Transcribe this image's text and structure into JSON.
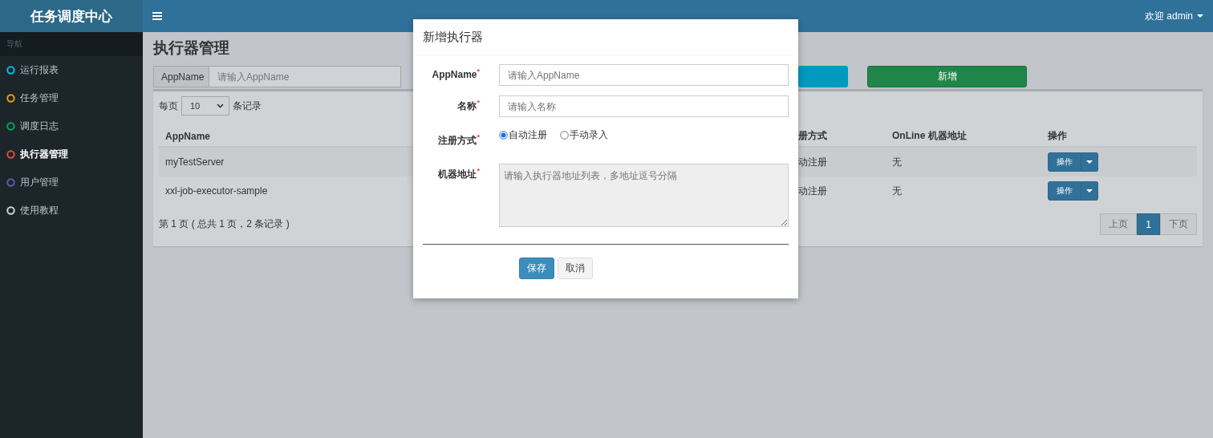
{
  "brand": "任务调度中心",
  "header": {
    "user": "欢迎 admin"
  },
  "sidebar": {
    "heading": "导航",
    "items": [
      {
        "label": "运行报表",
        "color": "#00c0ef",
        "selected": false
      },
      {
        "label": "任务管理",
        "color": "#f39c12",
        "selected": false
      },
      {
        "label": "调度日志",
        "color": "#00a65a",
        "selected": false
      },
      {
        "label": "执行器管理",
        "color": "#dd4b39",
        "selected": true
      },
      {
        "label": "用户管理",
        "color": "#605ca8",
        "selected": false
      },
      {
        "label": "使用教程",
        "color": "#d2d6de",
        "selected": false
      }
    ]
  },
  "page_title": "执行器管理",
  "search": {
    "label": "AppName",
    "placeholder": "请输入AppName",
    "add_button": "新增"
  },
  "page_size": {
    "before": "每页",
    "value": "10",
    "after": "条记录"
  },
  "table": {
    "columns": [
      "AppName",
      "册方式",
      "OnLine 机器地址",
      "操作"
    ],
    "rows": [
      {
        "app_name": "myTestServer",
        "column_2": "动注册",
        "online": "无",
        "action": "操作"
      },
      {
        "app_name": "xxl-job-executor-sample",
        "column_2": "动注册",
        "online": "无",
        "action": "操作"
      }
    ]
  },
  "footer_info": "第 1 页 ( 总共 1 页，2 条记录 )",
  "pagination": [
    {
      "label": "上页",
      "selected": false
    },
    {
      "label": "1",
      "selected": true
    },
    {
      "label": "下页",
      "selected": false
    }
  ],
  "modal": {
    "title": "新增执行器",
    "fields": [
      {
        "kind": "text",
        "label": "AppName",
        "mark": "*",
        "placeholder": "请输入AppName"
      },
      {
        "kind": "text",
        "label": "名称",
        "mark": "*",
        "placeholder": "请输入名称"
      },
      {
        "kind": "radio",
        "label": "注册方式",
        "mark": "*",
        "options": [
          {
            "label": "自动注册",
            "selected": true
          },
          {
            "label": "手动录入",
            "selected": false
          }
        ]
      },
      {
        "kind": "textarea",
        "label": "机器地址",
        "mark": "*",
        "placeholder": "请输入执行器地址列表，多地址逗号分隔",
        "readonly": true
      }
    ],
    "buttons": [
      {
        "label": "保存",
        "kind": "primary"
      },
      {
        "label": "取消",
        "kind": "default"
      }
    ]
  }
}
